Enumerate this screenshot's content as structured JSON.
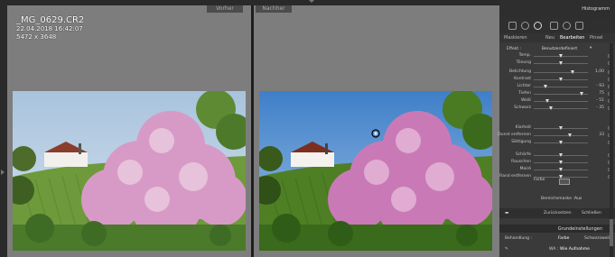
{
  "compare": {
    "before_label": "Vorher",
    "after_label": "Nachher"
  },
  "file_info": {
    "filename": "_MG_0629.CR2",
    "datetime": "22.04.2018 16:42:07",
    "dimensions": "5472 x 3648"
  },
  "panel": {
    "histogram_title": "Histogramm",
    "modes": [
      "Maskieren",
      "Neu",
      "Bearbeiten",
      "Pinsel"
    ],
    "active_mode": "Bearbeiten",
    "effect_label": "Effekt :",
    "effect_value": "Benutzerdefiniert",
    "sliders": [
      {
        "label": "Temp.",
        "pos": 0.5,
        "value": ""
      },
      {
        "label": "Tönung",
        "pos": 0.5,
        "value": ""
      },
      {
        "label": "Belichtung",
        "pos": 0.72,
        "value": "1,00"
      },
      {
        "label": "Kontrast",
        "pos": 0.5,
        "value": ""
      },
      {
        "label": "Lichter",
        "pos": 0.22,
        "value": "- 93"
      },
      {
        "label": "Tiefen",
        "pos": 0.88,
        "value": "75"
      },
      {
        "label": "Weiß",
        "pos": 0.25,
        "value": "- 51"
      },
      {
        "label": "Schwarz",
        "pos": 0.32,
        "value": "- 35"
      },
      {
        "label": "Klarheit",
        "pos": 0.5,
        "value": ""
      },
      {
        "label": "Dunst entfernen",
        "pos": 0.66,
        "value": "33"
      },
      {
        "label": "Sättigung",
        "pos": 0.5,
        "value": ""
      },
      {
        "label": "Schärfe",
        "pos": 0.5,
        "value": ""
      },
      {
        "label": "Rauschen",
        "pos": 0.5,
        "value": ""
      },
      {
        "label": "Moiré",
        "pos": 0.5,
        "value": ""
      },
      {
        "label": "Rand entfernen",
        "pos": 0.5,
        "value": ""
      }
    ],
    "color_label": "Farbe",
    "range_mask_label": "Bereichsmaske :",
    "range_mask_value": "Aus",
    "reset_label": "Zurücksetzen",
    "close_label": "Schließen",
    "basic_title": "Grundeinstellungen",
    "treatment_label": "Behandlung :",
    "treatment_color": "Farbe",
    "treatment_bw": "Schwarzweiß",
    "wb_label": "WA :",
    "wb_value": "Wie Aufnahme"
  }
}
